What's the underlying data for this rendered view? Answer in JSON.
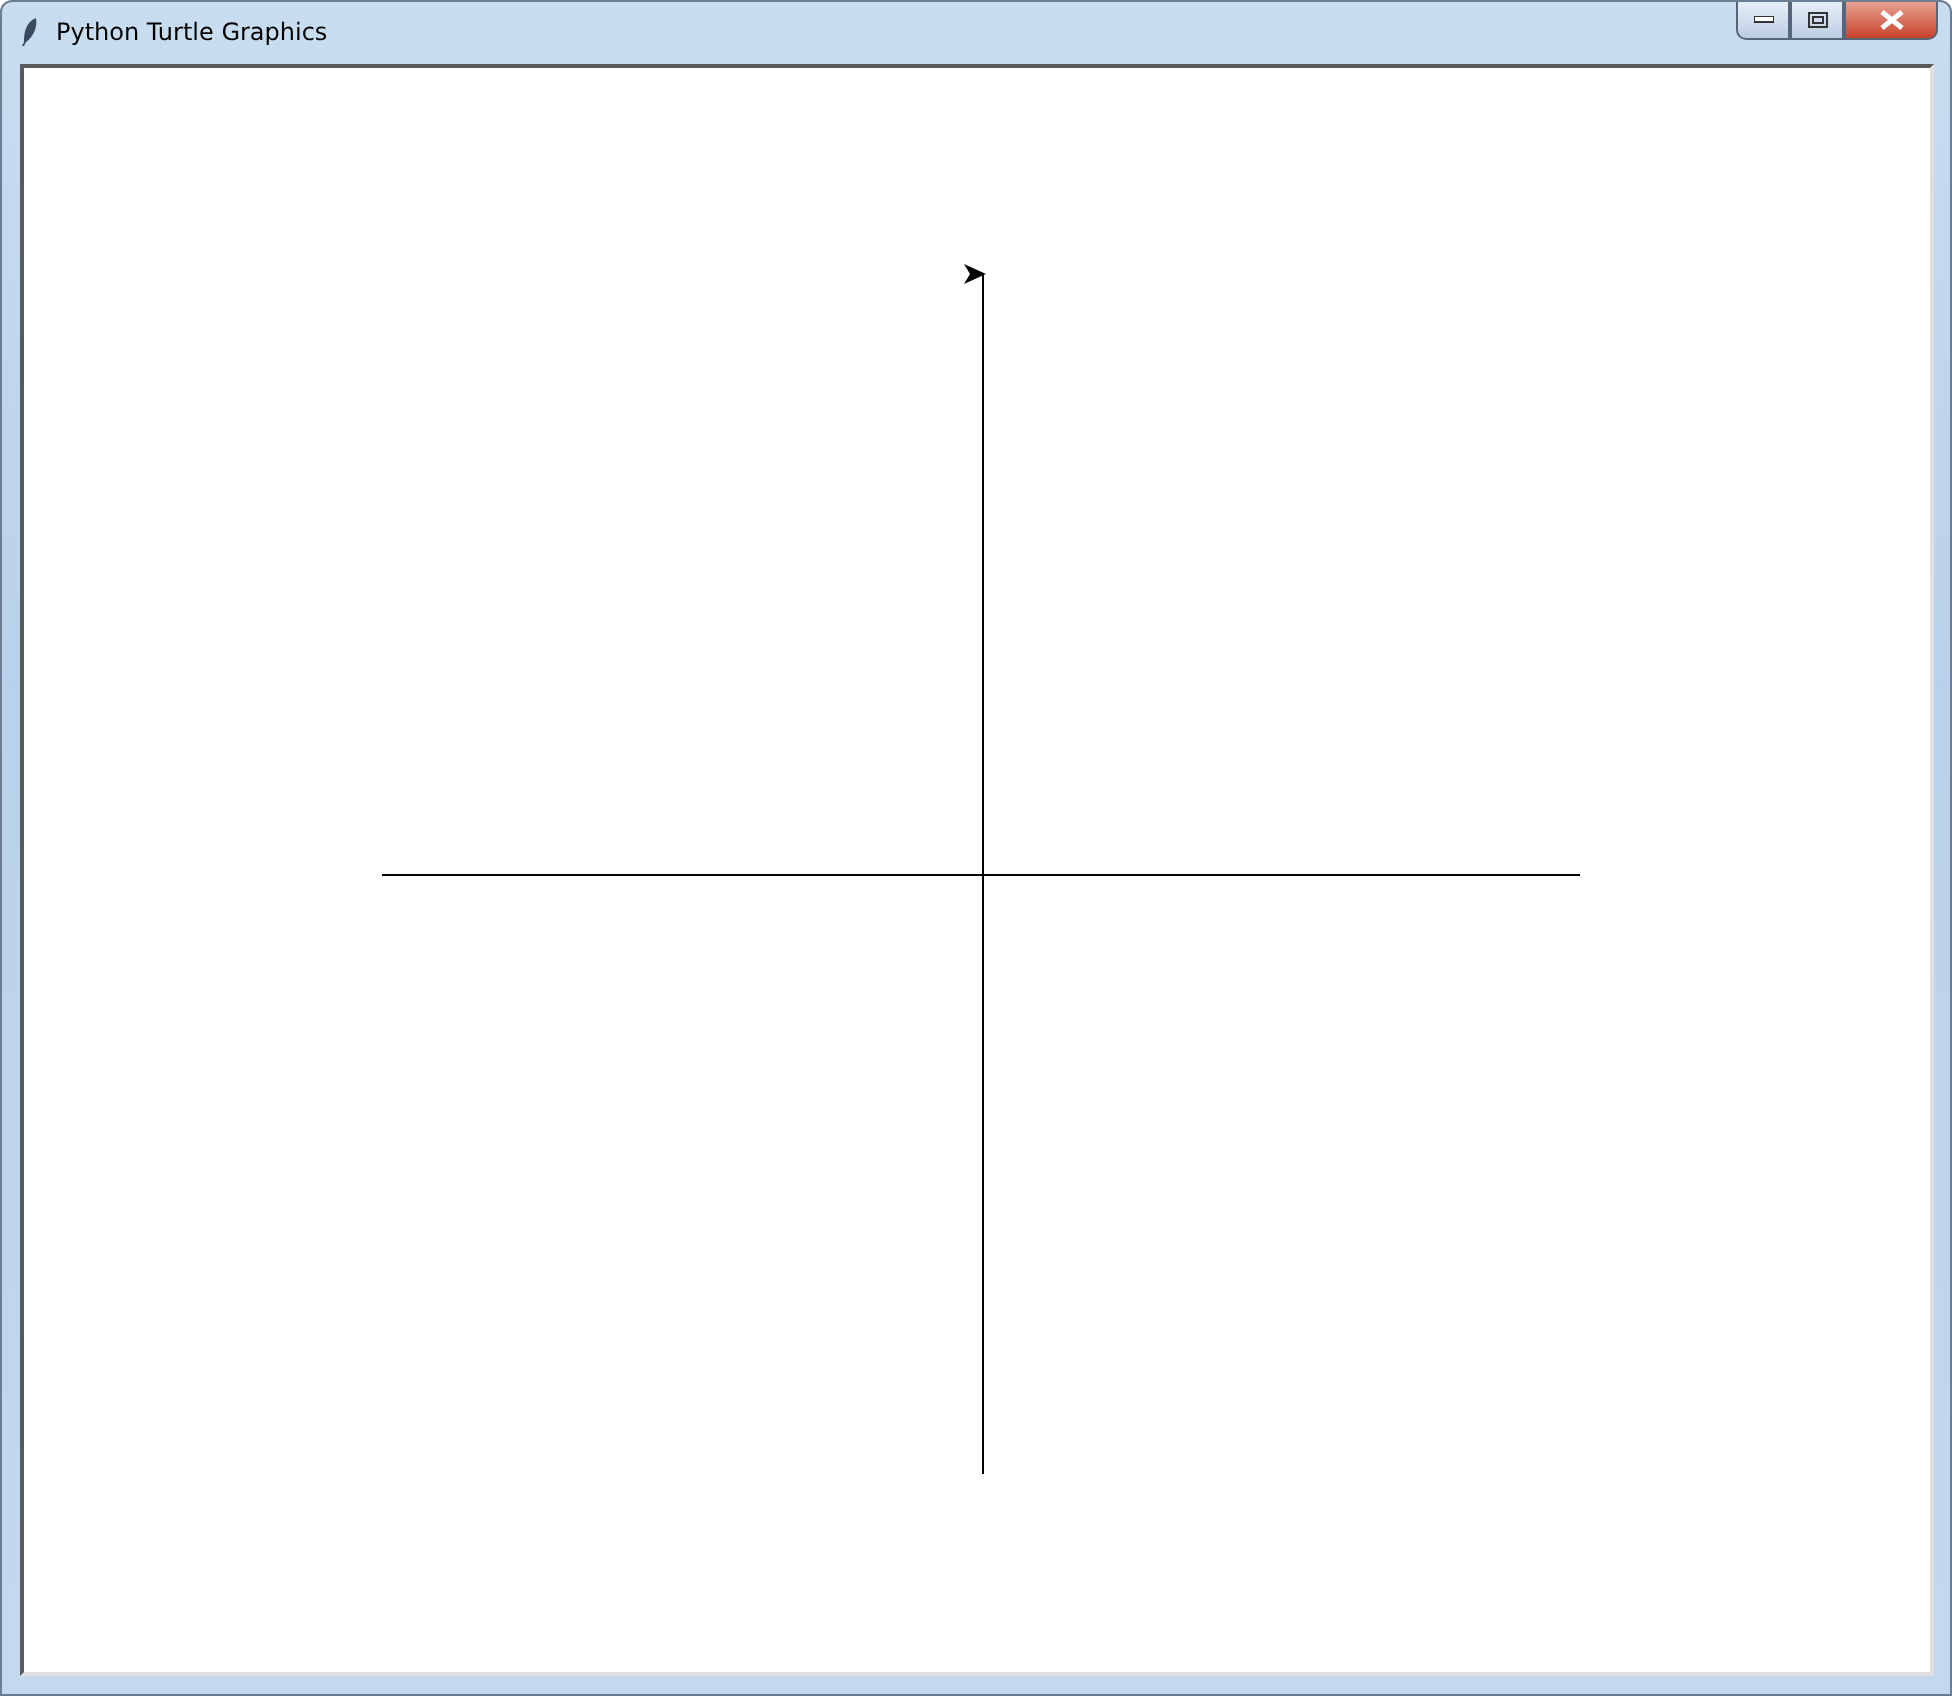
{
  "window": {
    "title": "Python Turtle Graphics"
  }
}
